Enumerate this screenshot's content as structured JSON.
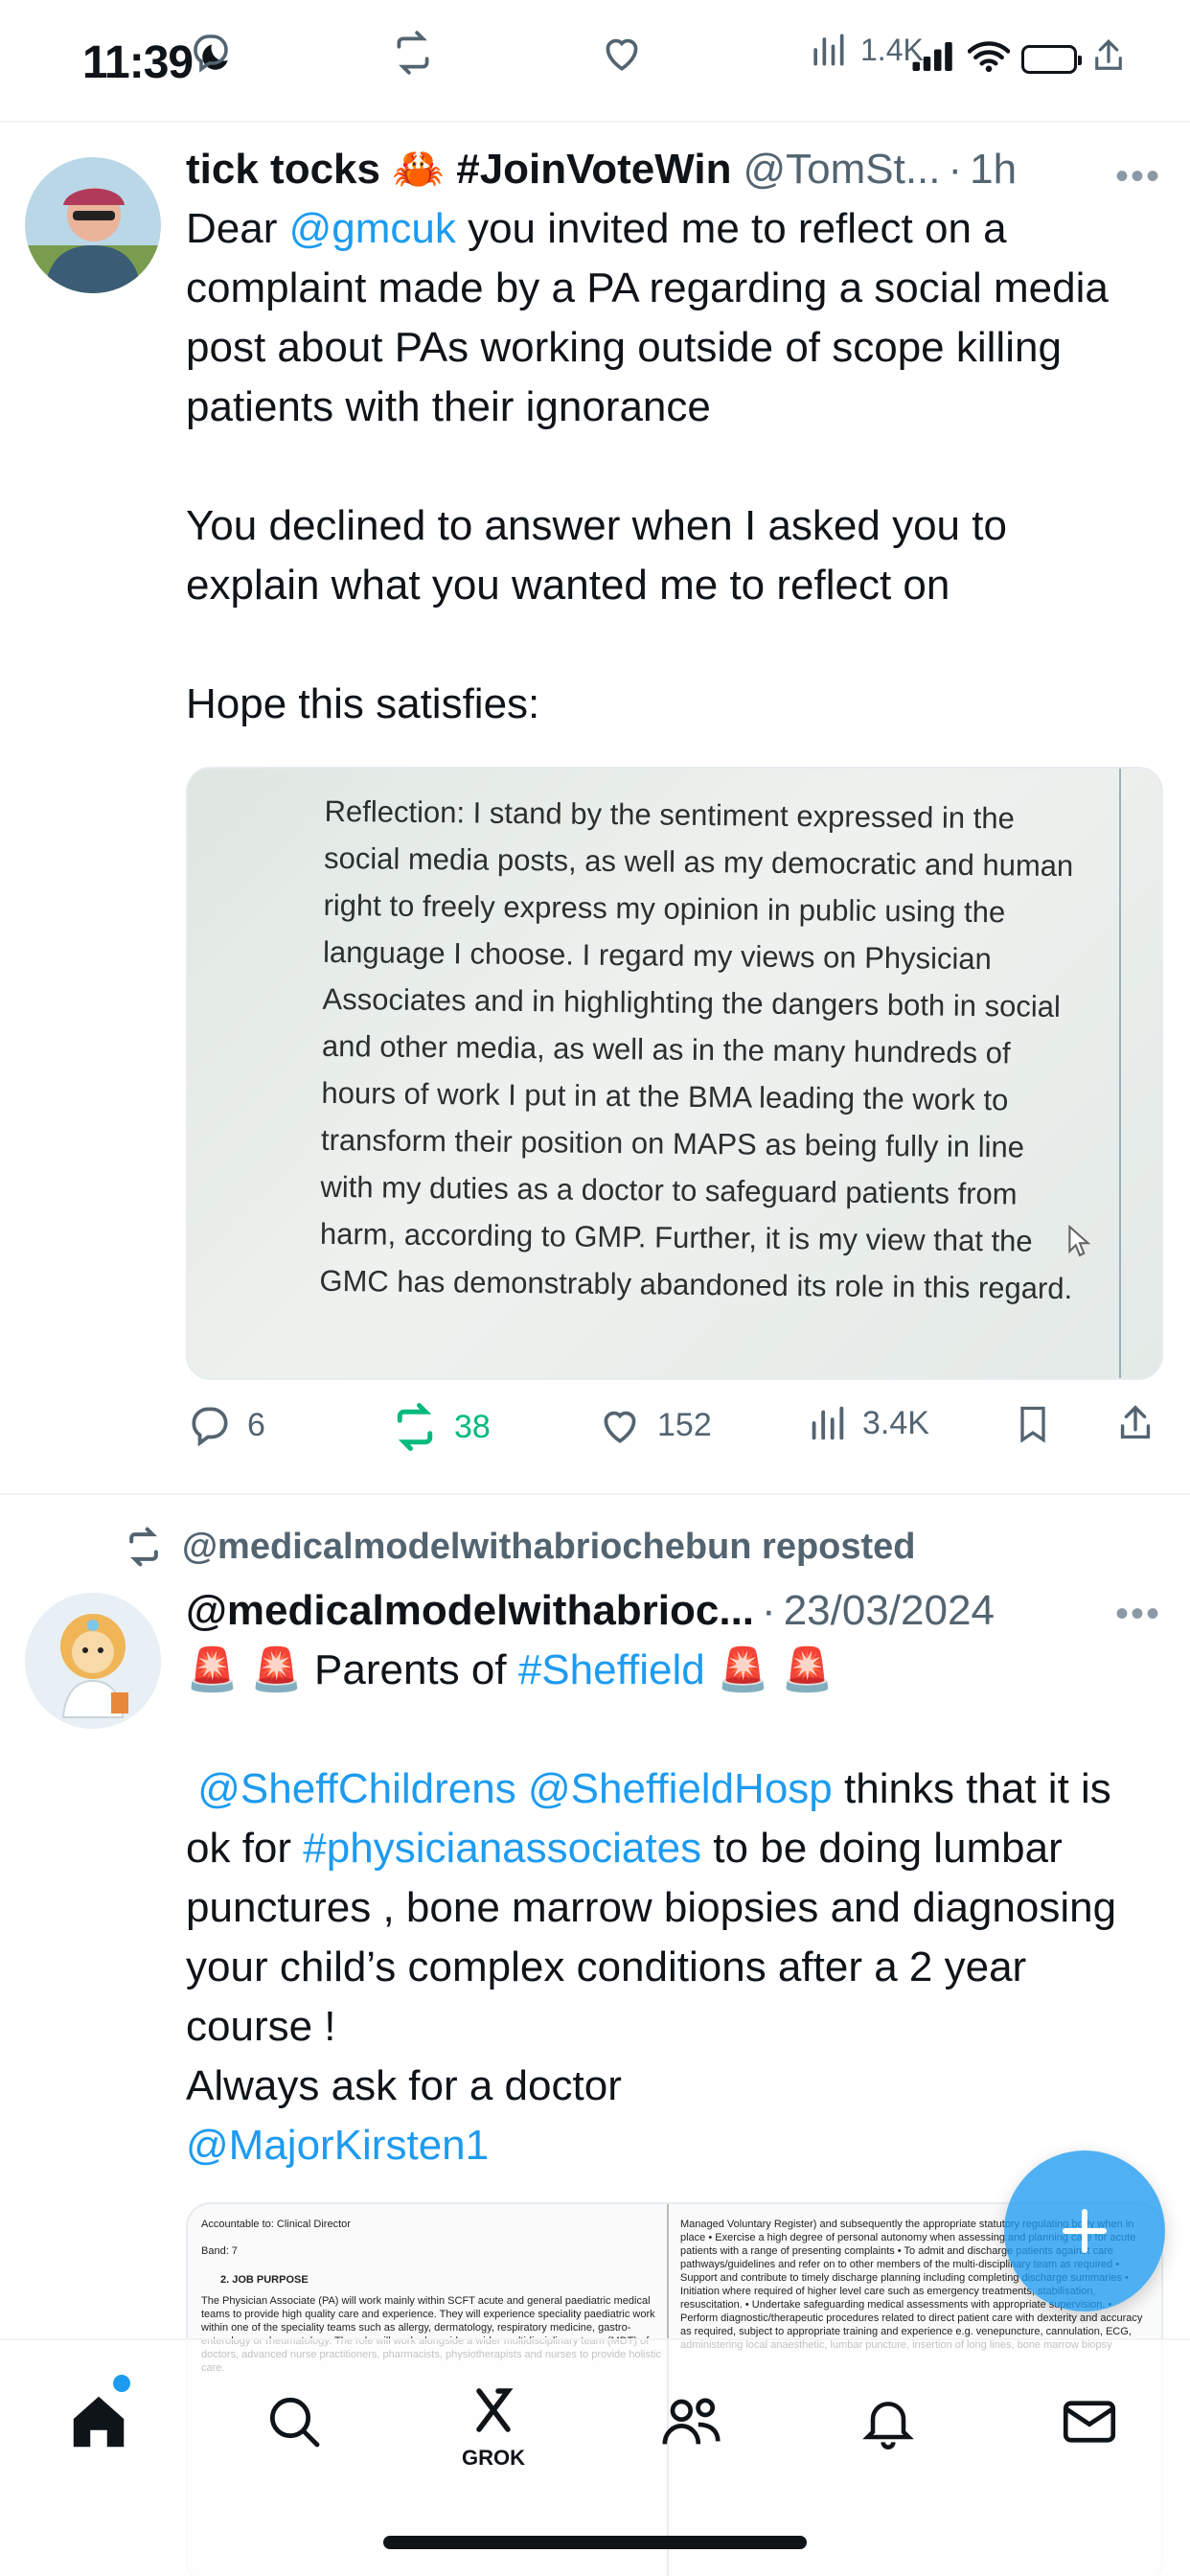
{
  "status_bar": {
    "time": "11:39",
    "focus_icon": "moon-icon",
    "battery": "charging"
  },
  "prev_tweet_actions": {
    "views": "1.4K"
  },
  "tweet1": {
    "name": "tick tocks 🦀 #JoinVoteWin",
    "handle": "@TomSt...",
    "time": "1h",
    "text": {
      "p1_prefix": "Dear ",
      "p1_mention": "@gmcuk",
      "p1_rest": " you invited me to reflect on a complaint made by a PA regarding a social media post about PAs working outside of scope killing patients with their ignorance",
      "p2": "You declined to answer when I asked you to explain what you wanted me to reflect on",
      "p3": "Hope this satisfies:"
    },
    "image_text": "Reflection: I stand by the sentiment expressed in the social media posts, as well as my democratic and human right to freely express my opinion in public using the language I choose. I regard my views on Physician Associates and in highlighting the dangers both in social and other media, as well as in the many hundreds of hours of work I put in at the BMA leading the work to transform their position on MAPS as being fully in line with my duties as a doctor to safeguard patients from harm, according to GMP. Further, it is my view that the GMC has demonstrably abandoned its role in this regard.",
    "actions": {
      "replies": "6",
      "reposts": "38",
      "likes": "152",
      "views": "3.4K"
    }
  },
  "tweet2": {
    "repost_label": "@medicalmodelwithabriochebun reposted",
    "name": "@medicalmodelwithabrioc...",
    "time": "23/03/2024",
    "text": {
      "l1_prefix": "🚨 🚨 Parents of ",
      "l1_tag": "#Sheffield",
      "l1_suffix": " 🚨 🚨",
      "m1": "@SheffChildrens",
      "m2": "@SheffieldHosp",
      "l2_rest": " thinks that it is ok for ",
      "tag2": "#physicianassociates",
      "l2_end": " to be doing lumbar punctures , bone marrow biopsies and diagnosing your child’s complex conditions after a 2 year course !",
      "l3": "Always ask for a doctor",
      "m3": "@MajorKirsten1"
    },
    "doc": {
      "accountable": "Accountable to: Clinical Director",
      "band": "Band:  7",
      "heading": "2.   JOB PURPOSE",
      "purpose": "The Physician Associate (PA) will work mainly within SCFT acute and general paediatric medical teams to provide high quality care and experience. They will experience speciality paediatric work within one of the speciality teams such as allergy, dermatology, respiratory medicine, gastro-enterology or rheumatology. The role will work alongside a wider multidisciplinary team (MDT) of doctors, advanced nurse practitioners, pharmacists, physiotherapists and nurses to provide holistic care.",
      "right_col": "Managed Voluntary Register) and subsequently the appropriate statutory regulating body when in place • Exercise a high degree of personal autonomy when assessing and planning care for acute patients with a range of presenting complaints • To admit and discharge patients against care pathways/guidelines and refer on to other members of the multi-disciplinary team as required • Support and contribute to timely discharge planning including completing discharge summaries • Initiation where required of higher level care such as emergency treatments, stabilisation, resuscitation. • Undertake safeguarding medical assessments with appropriate supervision. • Perform diagnostic/therapeutic procedures related to direct patient care with dexterity and accuracy as required, subject to appropriate training and experience e.g. venepuncture, cannulation, ECG, administering local anaesthetic, lumbar puncture, insertion of long lines, bone marrow biopsy"
    }
  },
  "bottom_nav": {
    "grok_label": "GROK"
  },
  "colors": {
    "link": "#1d9bf0",
    "repost": "#00ba7c",
    "muted": "#536471"
  }
}
